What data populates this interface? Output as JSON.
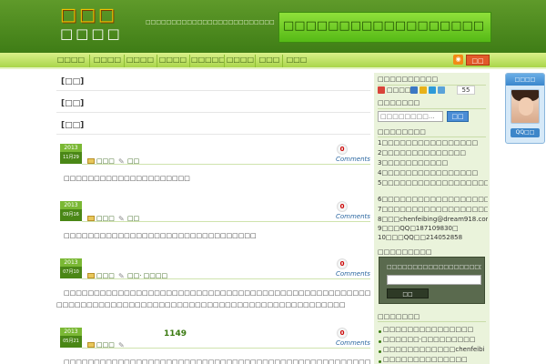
{
  "header": {
    "logo_top": "□□□",
    "logo_bottom": "□□□□",
    "tagline": "□□□□□□□□□□□□□□□□□□□□□□□□□□□□□□□□□□□□□□□□□",
    "banner_text": "□□□□□□□□□□□□□□□□□□"
  },
  "nav": {
    "items": [
      {
        "label": "□□□□"
      },
      {
        "label": "□□□□"
      },
      {
        "label": "□□□□"
      },
      {
        "label": "□□□□"
      },
      {
        "label": "□□□□□"
      },
      {
        "label": "□□□□"
      },
      {
        "label": "□□□"
      },
      {
        "label": "□□□"
      }
    ],
    "subscribe_label": "□□"
  },
  "main": {
    "category_links": [
      {
        "label": "[□□]"
      },
      {
        "label": "[□□]"
      },
      {
        "label": "[□□]"
      }
    ],
    "posts": [
      {
        "year": "2013",
        "day": "11月29",
        "category": "□□□",
        "tag": "□□",
        "comments": "0",
        "comments_label": "Comments",
        "excerpt": "□□□□□□□□□□□□□□□□□□□□□"
      },
      {
        "year": "2013",
        "day": "09月16",
        "category": "□□□",
        "tag": "□□",
        "comments": "0",
        "comments_label": "Comments",
        "excerpt": "□□□□□□□□□□□□□□□□□□□□□□□□□□□□□□□□"
      },
      {
        "year": "2013",
        "day": "07月10",
        "category": "□□□",
        "tag": "□□· □□□□",
        "comments": "0",
        "comments_label": "Comments",
        "excerpt_line1": "□□□□□□□□□□□□□□□□□□□□□□□□□□□□□□□□□□□□□□□□□□□□□□□□□□□□□□□□□□□□□□□□□□□□□□",
        "excerpt_line2": "□□□□□□□□□□□□□□□□□□□□□□□□□□□□□□□□□□□□□□□□□□□□□□□□"
      },
      {
        "year": "2013",
        "day": "05月21",
        "category": "□□□",
        "views": "1149",
        "comments": "0",
        "comments_label": "Comments",
        "excerpt": "□□□□□□□□□□□□□□□□□□□□□□□□□□□□□□□□□□□□□□□□□□□□□□□□□□□□□□"
      }
    ]
  },
  "sidebar": {
    "share_title": "□□□□□□□□□□",
    "share_label": "□□□□",
    "share_count": "55",
    "search_title": "□□□□□□□",
    "search_placeholder": "□□□□□□□□...",
    "search_button": "□□",
    "links_title": "□□□□□□□□",
    "links": [
      {
        "text": "1□□□□□□□□□□□□□□□□"
      },
      {
        "text": "2□□□□□□□□□□□□□□"
      },
      {
        "text": "3□□□□□□□□□□□"
      },
      {
        "text": "4□□□□□□□□□□□□□□□□"
      },
      {
        "text": "5□□□□□□□□□□□□□□□□□□□□□□□□□□□□□□□□"
      },
      {
        "text": "6□□□□□□□□□□□□□□□□□□□□□□□□□□□□□□□□□"
      },
      {
        "text": "7□□□□□□□□□□□□□□□□□□□□□□□"
      },
      {
        "text": "8□□□chenfeibing@dream918.com"
      },
      {
        "text": "9□□□QQ□187109830□"
      },
      {
        "text": "10□□□QQ□□214052858"
      }
    ],
    "subscribe_title": "□□□□□□□□□",
    "subscribe_label": "□□□□□□□□□□□□□□□□□□□",
    "subscribe_button": "□□",
    "recent_title": "□□□□□□□",
    "recent": [
      {
        "text": "□□□□□□□□□□□□□□□"
      },
      {
        "text": "□□□□□□·□□□□□□□□□"
      },
      {
        "text": "□□□□□□□□□□□□chenfeibing.org"
      },
      {
        "text": "□□□□□□□□□□□□□□"
      }
    ]
  },
  "cs_widget": {
    "title": "□□□□",
    "button": "QQ□□"
  }
}
